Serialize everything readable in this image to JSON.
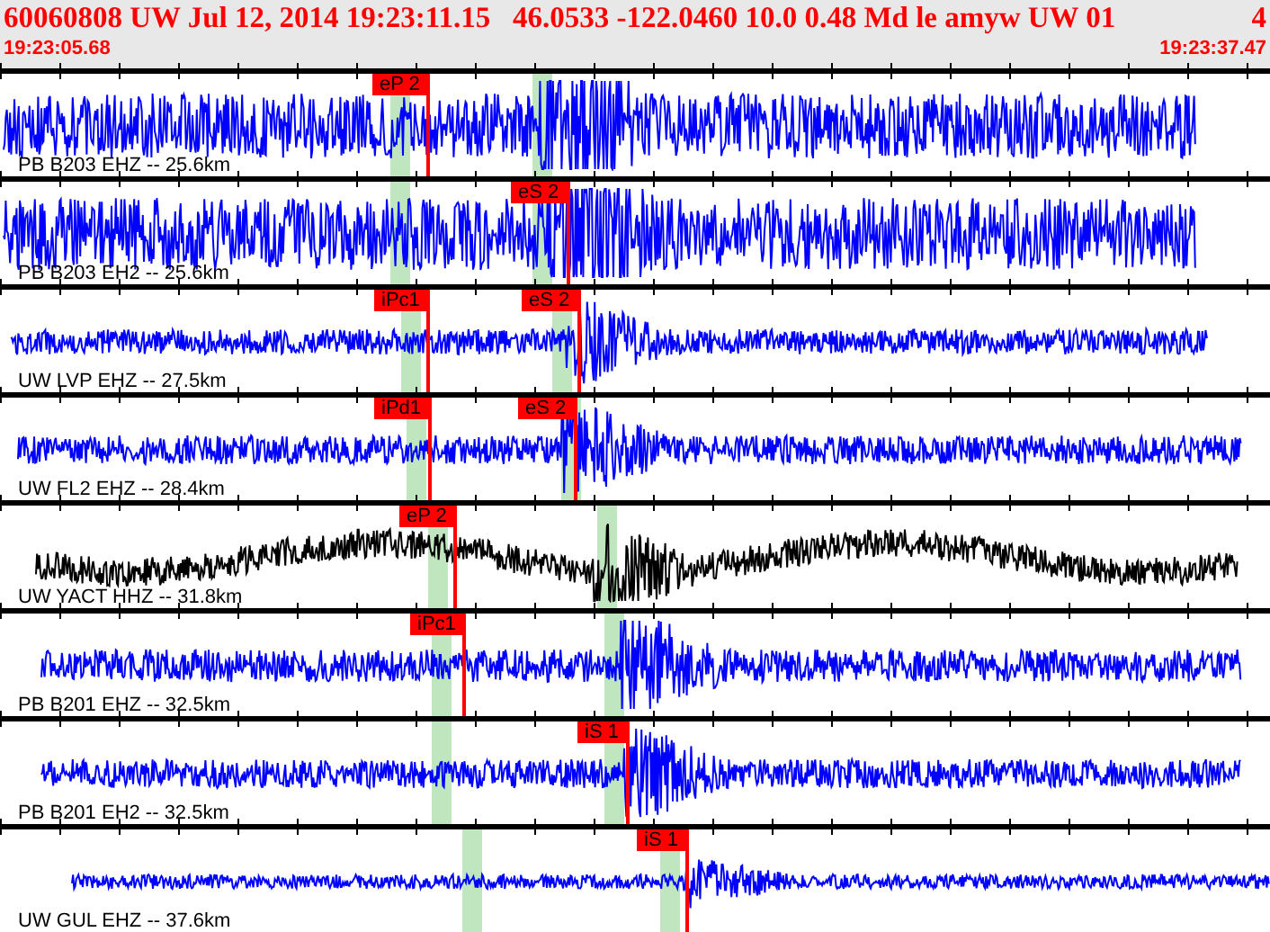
{
  "header": {
    "title": "60060808 UW Jul 12, 2014 19:23:11.15   46.0533 -122.0460 10.0 0.48 Md le amyw UW 01",
    "trailing": "4",
    "start_time": "19:23:05.68",
    "end_time": "19:23:37.47"
  },
  "traces": [
    {
      "label": "PB B203 EHZ -- 25.6km",
      "color": "#0000ff",
      "picks": [
        {
          "label": "eP 2"
        }
      ]
    },
    {
      "label": "PB B203 EH2 -- 25.6km",
      "color": "#0000ff",
      "picks": [
        {
          "label": "eS 2"
        }
      ]
    },
    {
      "label": "UW LVP EHZ -- 27.5km",
      "color": "#0000ff",
      "picks": [
        {
          "label": "iPc1"
        },
        {
          "label": "eS 2"
        }
      ]
    },
    {
      "label": "UW FL2 EHZ -- 28.4km",
      "color": "#0000ff",
      "picks": [
        {
          "label": "iPd1"
        },
        {
          "label": "eS 2"
        }
      ]
    },
    {
      "label": "UW YACT HHZ -- 31.8km",
      "color": "#000000",
      "picks": [
        {
          "label": "eP 2"
        }
      ]
    },
    {
      "label": "PB B201 EHZ -- 32.5km",
      "color": "#0000ff",
      "picks": [
        {
          "label": "iPc1"
        }
      ]
    },
    {
      "label": "PB B201 EH2 -- 32.5km",
      "color": "#0000ff",
      "picks": [
        {
          "label": "iS 1"
        }
      ]
    },
    {
      "label": "UW GUL EHZ -- 37.6km",
      "color": "#0000ff",
      "picks": [
        {
          "label": "iS 1"
        }
      ]
    }
  ]
}
